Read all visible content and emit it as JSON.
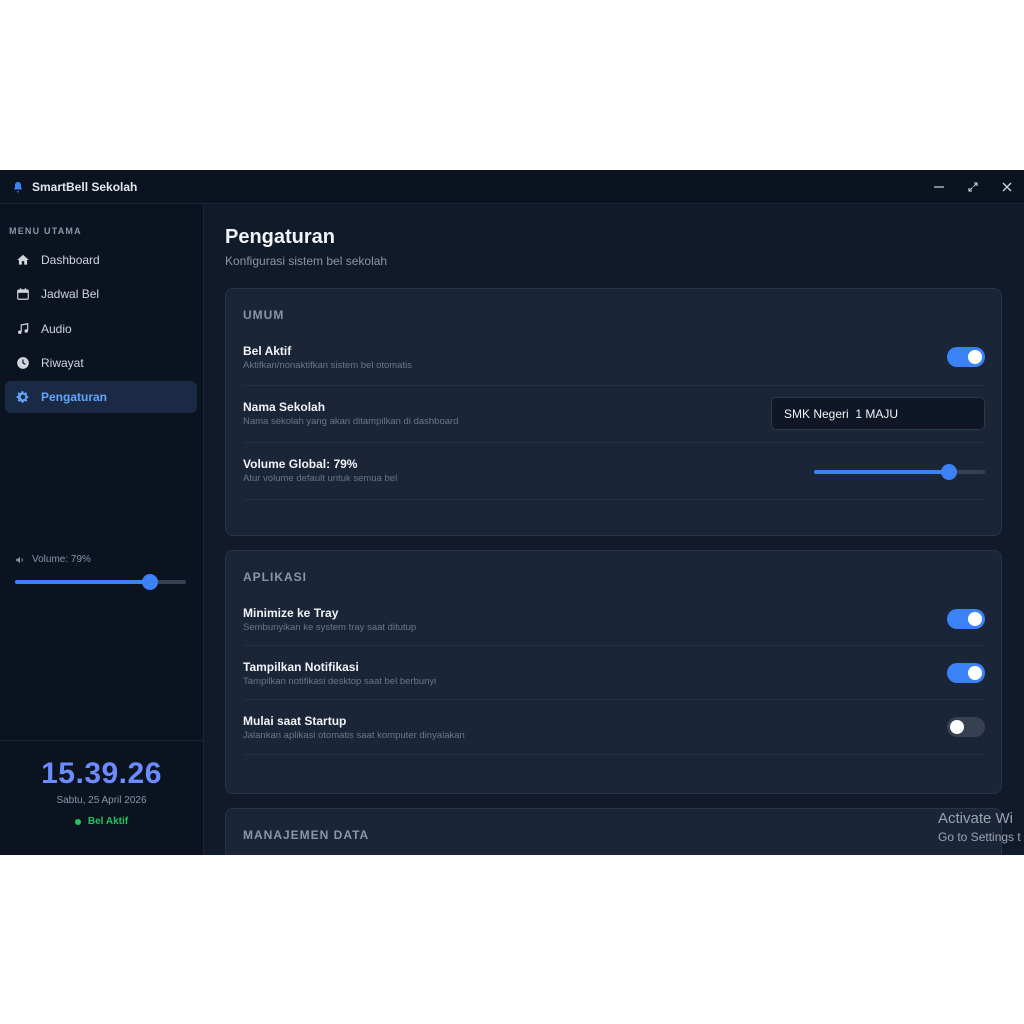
{
  "window": {
    "title": "SmartBell Sekolah",
    "controls": [
      "minimize",
      "maximize",
      "close"
    ]
  },
  "sidebar": {
    "menu_label": "MENU UTAMA",
    "items": [
      {
        "label": "Dashboard",
        "icon": "home-icon",
        "active": false
      },
      {
        "label": "Jadwal Bel",
        "icon": "calendar-icon",
        "active": false
      },
      {
        "label": "Audio",
        "icon": "music-icon",
        "active": false
      },
      {
        "label": "Riwayat",
        "icon": "clock-icon",
        "active": false
      },
      {
        "label": "Pengaturan",
        "icon": "gear-icon",
        "active": true
      }
    ],
    "volume": {
      "label": "Volume: 79%",
      "value": 79
    },
    "clock": "15.39.26",
    "date": "Sabtu, 25 April 2026",
    "status": "Bel Aktif"
  },
  "main": {
    "title": "Pengaturan",
    "subtitle": "Konfigurasi sistem bel sekolah",
    "sections": {
      "umum": {
        "title": "UMUM",
        "bel_aktif": {
          "title": "Bel Aktif",
          "desc": "Aktifkan/nonaktifkan sistem bel otomatis",
          "enabled": true
        },
        "nama_sekolah": {
          "title": "Nama Sekolah",
          "desc": "Nama sekolah yang akan ditampilkan di dashboard",
          "value": "SMK Negeri  1 MAJU"
        },
        "volume_global": {
          "title": "Volume Global: 79%",
          "desc": "Atur volume default untuk semua bel",
          "value": 79
        }
      },
      "aplikasi": {
        "title": "APLIKASI",
        "minimize_tray": {
          "title": "Minimize ke Tray",
          "desc": "Sembunyikan ke system tray saat ditutup",
          "enabled": true
        },
        "notifikasi": {
          "title": "Tampilkan Notifikasi",
          "desc": "Tampilkan notifikasi desktop saat bel berbunyi",
          "enabled": true
        },
        "startup": {
          "title": "Mulai saat Startup",
          "desc": "Jalankan aplikasi otomatis saat komputer dinyalakan",
          "enabled": false
        }
      },
      "manajemen_data": {
        "title": "MANAJEMEN DATA"
      }
    }
  },
  "watermark": {
    "line1": "Activate Wi",
    "line2": "Go to Settings t"
  },
  "colors": {
    "accent": "#3b82f6",
    "clock": "#6b8cff",
    "status": "#22c55e",
    "background": "#101828"
  }
}
